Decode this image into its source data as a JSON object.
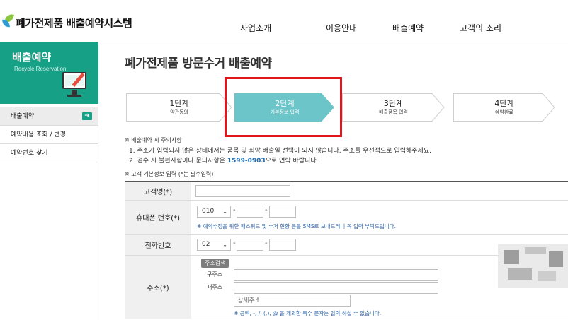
{
  "header": {
    "logo_text": "폐가전제품 배출예약시스템",
    "nav": [
      "사업소개",
      "이용안내",
      "배출예약",
      "고객의 소리"
    ]
  },
  "sidebar": {
    "banner_title": "배출예약",
    "banner_subtitle": "Recycle Reservation",
    "items": [
      {
        "label": "배출예약",
        "arrow": "➔"
      },
      {
        "label": "예약내용 조회 / 변경"
      },
      {
        "label": "예약번호 찾기"
      }
    ]
  },
  "main": {
    "title": "폐가전제품 방문수거 배출예약",
    "steps": [
      {
        "title": "1단계",
        "sub": "약관동의"
      },
      {
        "title": "2단계",
        "sub": "기본정보 입력"
      },
      {
        "title": "3단계",
        "sub": "배출품목 입력"
      },
      {
        "title": "4단계",
        "sub": "예약완료"
      }
    ],
    "active_step": 2,
    "notice": {
      "heading": "※ 배출예약 시 주의사항",
      "line1": "1. 주소가 입력되지 않은 상태에서는 품목 및 희망 배출일 선택이 되지 않습니다. 주소를 우선적으로 입력해주세요.",
      "line2_pre": "2. 검수 시 불편사항이나 문의사항은 ",
      "line2_tel": "1599-0903",
      "line2_post": "으로 연락 바랍니다."
    },
    "form_heading": "※ 고객 기본정보 입력 (*는 필수입력)",
    "form": {
      "name_label": "고객명(*)",
      "mobile_label": "휴대폰 번호(*)",
      "mobile_prefix": "010",
      "mobile_hint": "※ 예약수정을 위한 패스워드 및 수거 현황 등을 SMS로 보내드리니 꼭 입력 부탁드립니다.",
      "phone_label": "전화번호",
      "phone_prefix": "02",
      "address_label": "주소(*)",
      "address_search_button": "주소검색",
      "old_address_label": "구주소",
      "new_address_label": "새주소",
      "detail_placeholder": "상세주소",
      "address_hint": "※ 공백, -, /, (,), @ 을 제외한 특수 문자는 입력 하실 수 없습니다."
    }
  },
  "colors": {
    "brand_green": "#16a086",
    "active_step": "#6cc5c8",
    "highlight_red": "#e0161e",
    "link_blue": "#1f6fb6"
  }
}
